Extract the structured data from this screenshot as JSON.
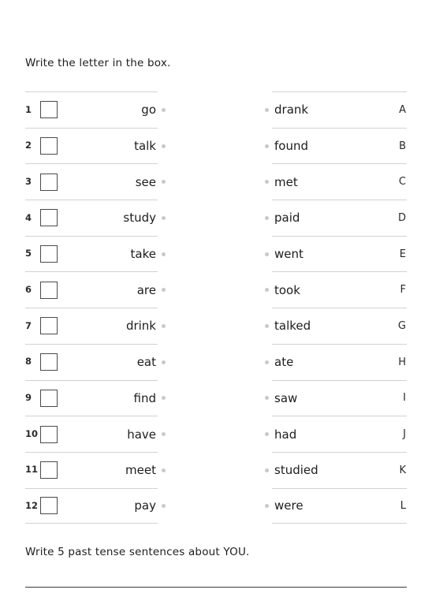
{
  "worksheet": {
    "instruction_top": "Write the letter in the box.",
    "instruction_bottom": "Write 5 past tense sentences about YOU.",
    "left_column": [
      {
        "number": "1",
        "word": "go"
      },
      {
        "number": "2",
        "word": "talk"
      },
      {
        "number": "3",
        "word": "see"
      },
      {
        "number": "4",
        "word": "study"
      },
      {
        "number": "5",
        "word": "take"
      },
      {
        "number": "6",
        "word": "are"
      },
      {
        "number": "7",
        "word": "drink"
      },
      {
        "number": "8",
        "word": "eat"
      },
      {
        "number": "9",
        "word": "find"
      },
      {
        "number": "10",
        "word": "have"
      },
      {
        "number": "11",
        "word": "meet"
      },
      {
        "number": "12",
        "word": "pay"
      }
    ],
    "right_column": [
      {
        "letter": "A",
        "word": "drank"
      },
      {
        "letter": "B",
        "word": "found"
      },
      {
        "letter": "C",
        "word": "met"
      },
      {
        "letter": "D",
        "word": "paid"
      },
      {
        "letter": "E",
        "word": "went"
      },
      {
        "letter": "F",
        "word": "took"
      },
      {
        "letter": "G",
        "word": "talked"
      },
      {
        "letter": "H",
        "word": "ate"
      },
      {
        "letter": "I",
        "word": "saw"
      },
      {
        "letter": "J",
        "word": "had"
      },
      {
        "letter": "K",
        "word": "studied"
      },
      {
        "letter": "L",
        "word": "were"
      }
    ],
    "colors": {
      "text": "#1d1d1d",
      "rule": "#d2d2d2",
      "bullet": "#c9c9c9",
      "checkbox_border": "#4a4a4a",
      "writing_line": "#3a3a3a",
      "background": "#ffffff"
    }
  }
}
